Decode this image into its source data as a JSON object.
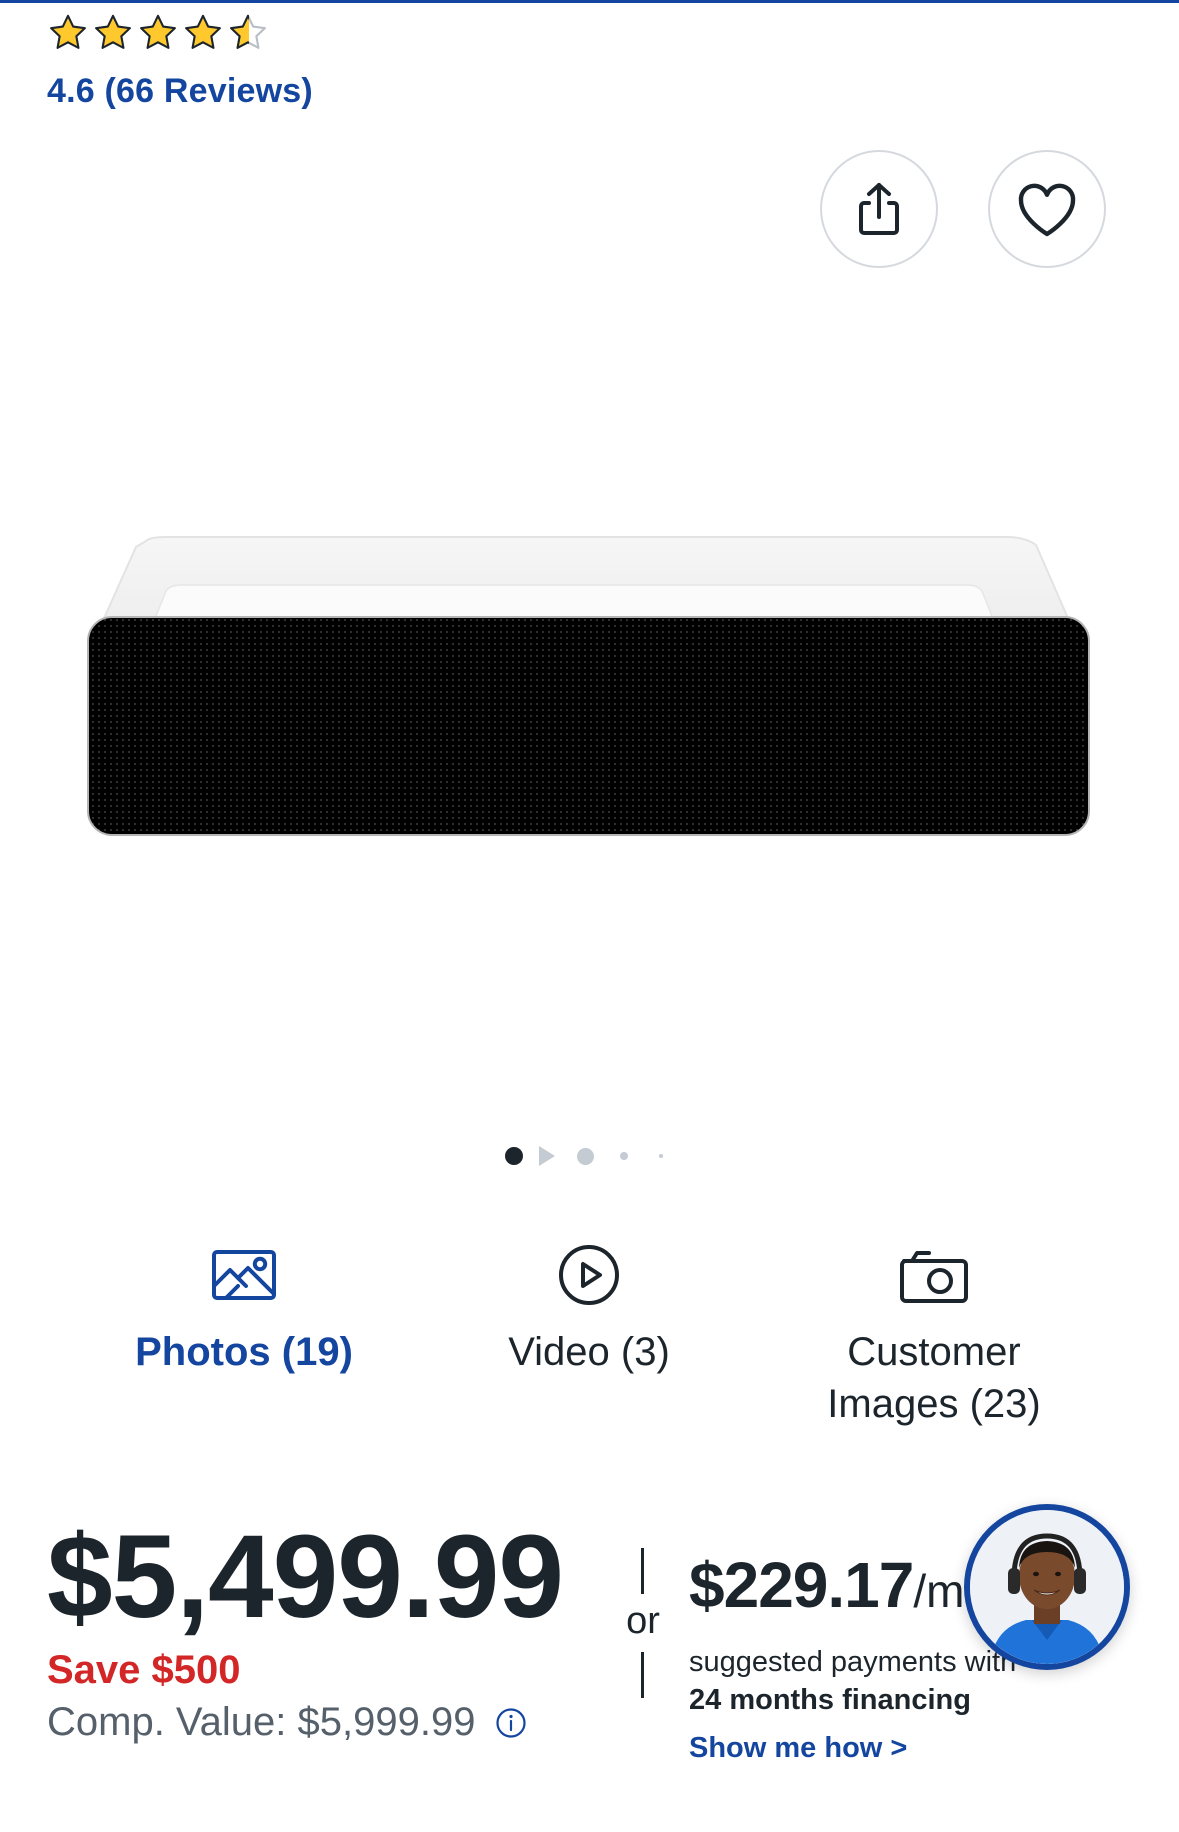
{
  "rating": {
    "value": 4.6,
    "max": 5,
    "text": "4.6 (66 Reviews)"
  },
  "actions": {
    "share_icon": "share-icon",
    "save_icon": "heart-icon"
  },
  "gallery": {
    "image_alt": "Projector product image",
    "slide_count": 5,
    "active_slide": 1
  },
  "media_tabs": {
    "photos": {
      "label": "Photos (19)",
      "icon": "image-icon"
    },
    "video": {
      "label": "Video (3)",
      "icon": "play-circle-icon"
    },
    "customer_images": {
      "label_line1": "Customer",
      "label_line2": "Images (23)",
      "icon": "camera-icon"
    }
  },
  "pricing": {
    "price": "$5,499.99",
    "save": "Save $500",
    "comp_value": "Comp. Value: $5,999.99",
    "or": "or",
    "monthly_price": "$229.17",
    "monthly_unit": "/mo",
    "suggested": "suggested payments with",
    "financing": "24 months financing",
    "show_me_how": "Show me how >"
  },
  "colors": {
    "brand_blue": "#1446a0",
    "star_gold": "#ffc82c",
    "save_red": "#d32626",
    "text_dark": "#1d252c"
  }
}
